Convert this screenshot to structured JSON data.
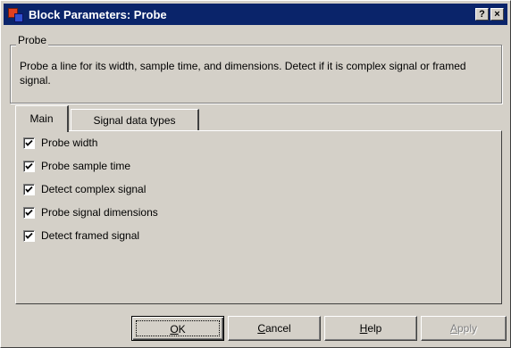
{
  "window": {
    "title": "Block Parameters: Probe"
  },
  "titlebar_buttons": {
    "help": "?",
    "close": "×"
  },
  "group": {
    "label": "Probe",
    "description": "Probe a line for its width, sample time, and dimensions. Detect if it is complex signal or framed signal."
  },
  "tabs": [
    {
      "label": "Main",
      "active": true
    },
    {
      "label": "Signal data types",
      "active": false
    }
  ],
  "checkboxes": [
    {
      "label": "Probe width",
      "checked": true
    },
    {
      "label": "Probe sample time",
      "checked": true
    },
    {
      "label": "Detect complex signal",
      "checked": true
    },
    {
      "label": "Probe signal dimensions",
      "checked": true
    },
    {
      "label": "Detect framed signal",
      "checked": true
    }
  ],
  "buttons": {
    "ok": {
      "pre": "",
      "mnemonic": "O",
      "post": "K"
    },
    "cancel": {
      "pre": "",
      "mnemonic": "C",
      "post": "ancel"
    },
    "help": {
      "pre": "",
      "mnemonic": "H",
      "post": "elp"
    },
    "apply": {
      "pre": "",
      "mnemonic": "A",
      "post": "pply",
      "disabled": true
    }
  },
  "icons": {
    "app": "simulink-block-icon",
    "check": "checkmark-icon"
  }
}
